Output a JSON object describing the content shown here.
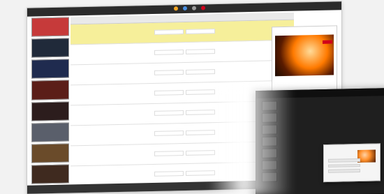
{
  "brand_color": "#d0021b",
  "toolbar": {
    "tabs": [],
    "icons": [
      {
        "name": "globe-icon",
        "color": "#f5a623"
      },
      {
        "name": "share-icon",
        "color": "#4a90e2"
      },
      {
        "name": "gear-icon",
        "color": "#9b9b9b"
      },
      {
        "name": "flag-icon",
        "color": "#d0021b"
      }
    ]
  },
  "list": {
    "headers": [],
    "rows": [
      {
        "title": "",
        "selected": true
      },
      {
        "title": "",
        "selected": false
      },
      {
        "title": "",
        "selected": false
      },
      {
        "title": "",
        "selected": false
      },
      {
        "title": "",
        "selected": false
      },
      {
        "title": "",
        "selected": false
      },
      {
        "title": "",
        "selected": false
      },
      {
        "title": "",
        "selected": false
      }
    ]
  },
  "preview": {
    "title": ""
  },
  "status": {
    "text": ""
  },
  "dialog": {
    "title": ""
  },
  "thumb_colors": [
    "#c63a3a",
    "#202a3a",
    "#1f2b4f",
    "#5b1e18",
    "#2c1d1d",
    "#5a5f6b",
    "#6a4b2a",
    "#3f2a1f"
  ]
}
